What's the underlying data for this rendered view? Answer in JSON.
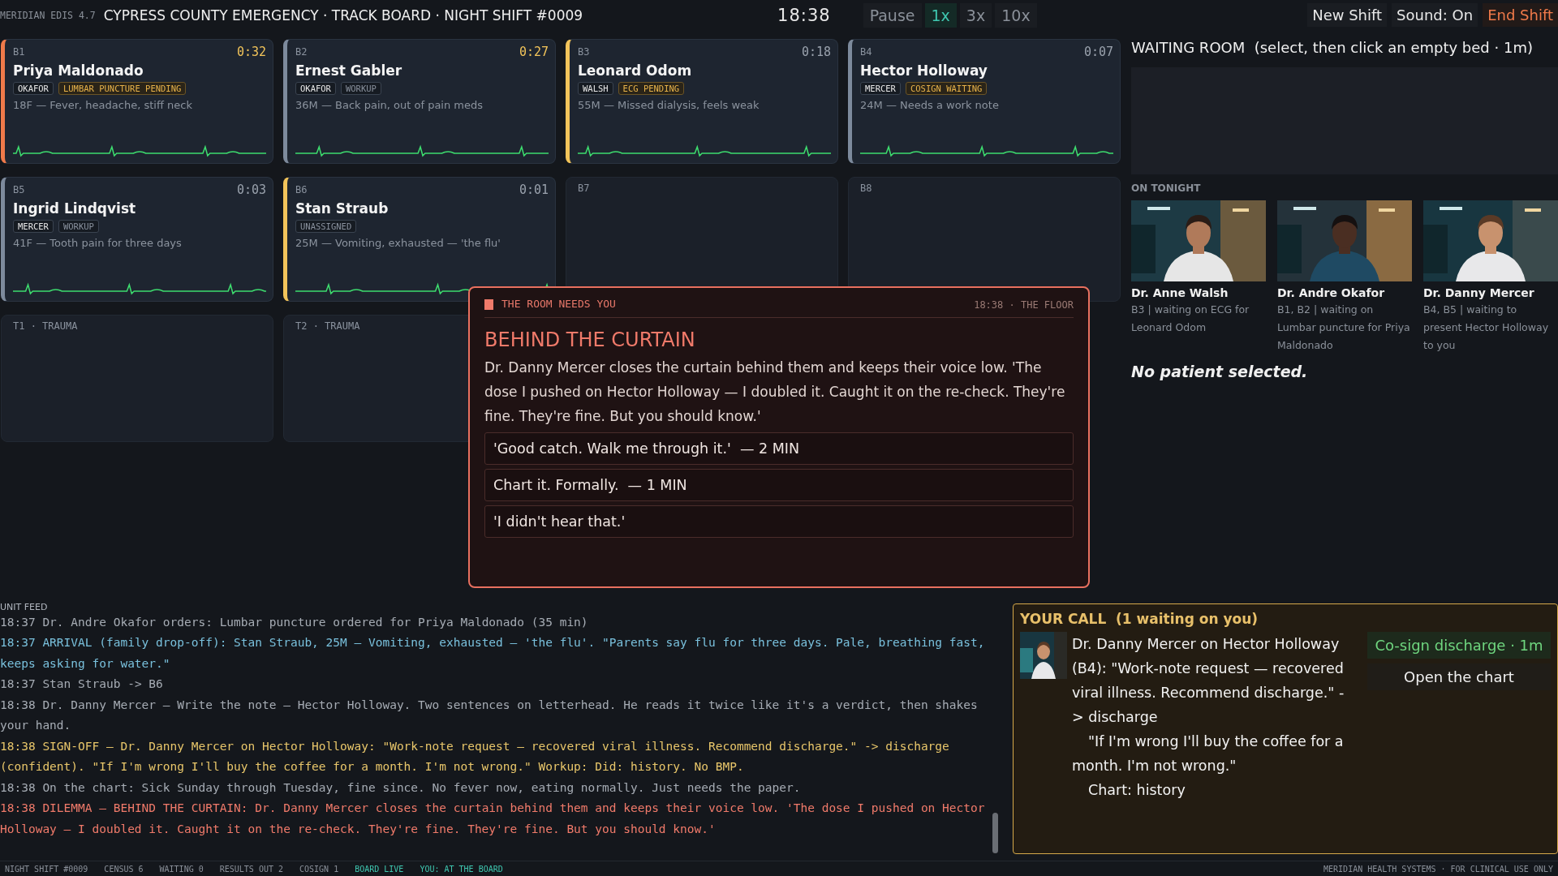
{
  "topbar": {
    "version": "MERIDIAN EDIS 4.7",
    "title": "CYPRESS COUNTY EMERGENCY · TRACK BOARD · NIGHT SHIFT #0009",
    "clock": "18:38",
    "speeds": [
      {
        "label": "Pause",
        "selected": false
      },
      {
        "label": "1x",
        "selected": true
      },
      {
        "label": "3x",
        "selected": false
      },
      {
        "label": "10x",
        "selected": false
      }
    ],
    "actions": [
      {
        "label": "New Shift",
        "kind": "normal"
      },
      {
        "label": "Sound: On",
        "kind": "normal"
      },
      {
        "label": "End Shift",
        "kind": "danger"
      }
    ]
  },
  "beds": [
    {
      "kind": "occupied",
      "bed": "B1",
      "timer": "0:32",
      "overdue": true,
      "color": "#f07a4a",
      "name": "Priya Maldonado",
      "tags": [
        {
          "label": "OKAFOR",
          "kind": "doctor"
        },
        {
          "label": "LUMBAR PUNCTURE PENDING",
          "kind": "pending"
        }
      ],
      "complaint": "18F — Fever, headache, stiff neck"
    },
    {
      "kind": "occupied",
      "bed": "B2",
      "timer": "0:27",
      "overdue": true,
      "color": "#7d8a9c",
      "name": "Ernest Gabler",
      "tags": [
        {
          "label": "OKAFOR",
          "kind": "doctor"
        },
        {
          "label": "WORKUP",
          "kind": "plain"
        }
      ],
      "complaint": "36M — Back pain, out of pain meds"
    },
    {
      "kind": "occupied",
      "bed": "B3",
      "timer": "0:18",
      "overdue": false,
      "color": "#f2c45a",
      "name": "Leonard Odom",
      "tags": [
        {
          "label": "WALSH",
          "kind": "doctor"
        },
        {
          "label": "ECG PENDING",
          "kind": "pending"
        }
      ],
      "complaint": "55M — Missed dialysis, feels weak"
    },
    {
      "kind": "occupied",
      "bed": "B4",
      "timer": "0:07",
      "overdue": false,
      "color": "#7d8a9c",
      "name": "Hector Holloway",
      "tags": [
        {
          "label": "MERCER",
          "kind": "doctor"
        },
        {
          "label": "COSIGN WAITING",
          "kind": "pending"
        }
      ],
      "complaint": "24M — Needs a work note"
    },
    {
      "kind": "occupied",
      "bed": "B5",
      "timer": "0:03",
      "overdue": false,
      "color": "#7d8a9c",
      "name": "Ingrid Lindqvist",
      "tags": [
        {
          "label": "MERCER",
          "kind": "doctor"
        },
        {
          "label": "WORKUP",
          "kind": "plain"
        }
      ],
      "complaint": "41F — Tooth pain for three days"
    },
    {
      "kind": "occupied",
      "bed": "B6",
      "timer": "0:01",
      "overdue": false,
      "color": "#f2c45a",
      "name": "Stan Straub",
      "tags": [
        {
          "label": "UNASSIGNED",
          "kind": "plain"
        }
      ],
      "complaint": "25M — Vomiting, exhausted — 'the flu'"
    },
    {
      "kind": "empty",
      "bed": "B7"
    },
    {
      "kind": "empty",
      "bed": "B8"
    },
    {
      "kind": "empty",
      "bed": "T1 · TRAUMA"
    },
    {
      "kind": "empty",
      "bed": "T2 · TRAUMA"
    }
  ],
  "waiting_room": {
    "title": "WAITING ROOM  (select, then click an empty bed · 1m)"
  },
  "on_tonight": {
    "label": "ON TONIGHT",
    "doctors": [
      {
        "name": "Dr. Anne Walsh",
        "note": "B3 | waiting on ECG for Leonard Odom"
      },
      {
        "name": "Dr. Andre Okafor",
        "note": "B1, B2 | waiting on Lumbar puncture for Priya Maldonado"
      },
      {
        "name": "Dr. Danny Mercer",
        "note": "B4, B5 | waiting to present Hector Holloway to you"
      }
    ]
  },
  "selection": "No patient selected.",
  "dilemma": {
    "kicker": "THE ROOM NEEDS YOU",
    "meta": "18:38 · THE FLOOR",
    "title": "BEHIND THE CURTAIN",
    "body": "Dr. Danny Mercer closes the curtain behind them and keeps their voice low. 'The dose I pushed on Hector Holloway — I doubled it. Caught it on the re-check. They're fine. They're fine. But you should know.'",
    "choices": [
      "'Good catch. Walk me through it.'  — 2 MIN",
      "Chart it. Formally.  — 1 MIN",
      "'I didn't hear that.'"
    ]
  },
  "feed": {
    "label": "UNIT FEED",
    "entries": [
      {
        "time": "18:37",
        "kind": "plain",
        "text": "Dr. Andre Okafor orders: Lumbar puncture ordered for Priya Maldonado (35 min)"
      },
      {
        "time": "18:37",
        "kind": "arrival",
        "text": "ARRIVAL (family drop-off): Stan Straub, 25M — Vomiting, exhausted — 'the flu'. \"Parents say flu for three days. Pale, breathing fast, keeps asking for water.\""
      },
      {
        "time": "18:37",
        "kind": "plain",
        "text": "Stan Straub -> B6"
      },
      {
        "time": "18:38",
        "kind": "plain",
        "text": "Dr. Danny Mercer — Write the note — Hector Holloway. Two sentences on letterhead. He reads it twice like it's a verdict, then shakes your hand."
      },
      {
        "time": "18:38",
        "kind": "signoff",
        "text": "SIGN-OFF — Dr. Danny Mercer on Hector Holloway: \"Work-note request — recovered viral illness. Recommend discharge.\" -> discharge (confident). \"If I'm wrong I'll buy the coffee for a month. I'm not wrong.\" Workup: Did: history. No BMP."
      },
      {
        "time": "18:38",
        "kind": "note",
        "text": "On the chart: Sick Sunday through Tuesday, fine since. No fever now, eating normally. Just needs the paper."
      },
      {
        "time": "18:38",
        "kind": "dilemma",
        "text": "DILEMMA — BEHIND THE CURTAIN: Dr. Danny Mercer closes the curtain behind them and keeps their voice low. 'The dose I pushed on Hector Holloway — I doubled it. Caught it on the re-check. They're fine. They're fine. But you should know.'"
      }
    ]
  },
  "your_call": {
    "title": "YOUR CALL  (1 waiting on you)",
    "body": "Dr. Danny Mercer on Hector Holloway (B4): \"Work-note request — recovered viral illness. Recommend discharge.\" -> discharge",
    "quote": "\"If I'm wrong I'll buy the coffee for a month. I'm not wrong.\"",
    "chart": "Chart: history",
    "actions": [
      {
        "label": "Co-sign discharge · 1m",
        "kind": "primary"
      },
      {
        "label": "Open the chart",
        "kind": "secondary"
      }
    ]
  },
  "status_bar": {
    "items": [
      {
        "label": "NIGHT SHIFT #0009",
        "kind": "plain"
      },
      {
        "label": "CENSUS 6",
        "kind": "plain"
      },
      {
        "label": "WAITING 0",
        "kind": "plain"
      },
      {
        "label": "RESULTS OUT 2",
        "kind": "plain"
      },
      {
        "label": "COSIGN 1",
        "kind": "plain"
      },
      {
        "label": "BOARD LIVE",
        "kind": "live"
      },
      {
        "label": "YOU: AT THE BOARD",
        "kind": "live"
      }
    ],
    "right": "MERIDIAN HEALTH SYSTEMS · FOR CLINICAL USE ONLY"
  }
}
